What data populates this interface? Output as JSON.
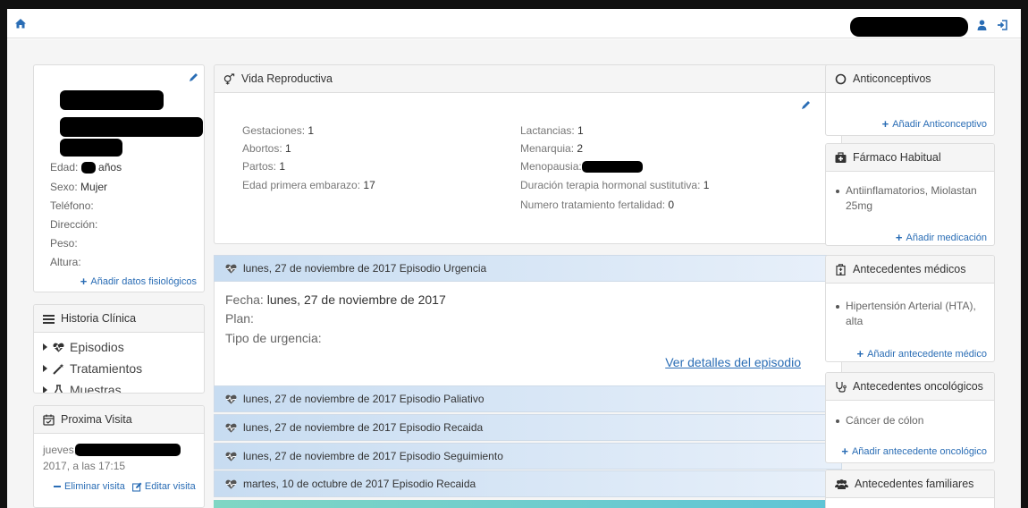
{
  "navbar": {
    "home_icon": "home-icon",
    "user_icon": "user-icon",
    "logout_icon": "sign-out-icon"
  },
  "profile": {
    "edad_label": "Edad:",
    "edad_unit": "años",
    "sexo_label": "Sexo:",
    "sexo_value": "Mujer",
    "telefono_label": "Teléfono:",
    "direccion_label": "Dirección:",
    "peso_label": "Peso:",
    "altura_label": "Altura:",
    "add_fisio": "Añadir datos fisiológicos"
  },
  "historia": {
    "title": "Historia Clínica",
    "items": [
      "Episodios",
      "Tratamientos",
      "Muestras"
    ]
  },
  "proxima": {
    "title": "Proxima Visita",
    "date_prefix": "jueves,",
    "date_suffix": "2017, a las 17:15",
    "eliminar": "Eliminar visita",
    "editar": "Editar visita"
  },
  "vida": {
    "title": "Vida Reproductiva",
    "left": [
      {
        "label": "Gestaciones:",
        "value": "1"
      },
      {
        "label": "Abortos:",
        "value": "1"
      },
      {
        "label": "Partos:",
        "value": "1"
      },
      {
        "label": "Edad primera embarazo:",
        "value": "17"
      }
    ],
    "right": [
      {
        "label": "Lactancias:",
        "value": "1"
      },
      {
        "label": "Menarquia:",
        "value": "2"
      },
      {
        "label": "Menopausia:",
        "value": ""
      },
      {
        "label": "Duración terapia hormonal sustitutiva:",
        "value": "1"
      },
      {
        "label": "Numero tratamiento fertalidad:",
        "value": "0"
      }
    ]
  },
  "episodios": {
    "open_title": "lunes, 27 de noviembre de 2017 Episodio Urgencia",
    "fecha_label": "Fecha:",
    "fecha_value": "lunes, 27 de noviembre de 2017",
    "plan_label": "Plan:",
    "tipo_label": "Tipo de urgencia:",
    "detalles": "Ver detalles del episodio",
    "collapsed": [
      "lunes, 27 de noviembre de 2017 Episodio Paliativo",
      "lunes, 27 de noviembre de 2017 Episodio Recaida",
      "lunes, 27 de noviembre de 2017 Episodio Seguimiento",
      "martes, 10 de octubre de 2017 Episodio Recaida"
    ]
  },
  "right": {
    "anticonceptivos": {
      "title": "Anticonceptivos",
      "add": "Añadir Anticonceptivo"
    },
    "farmaco": {
      "title": "Fármaco Habitual",
      "item": "Antiinflamatorios, Miolastan 25mg",
      "add": "Añadir medicación"
    },
    "medicos": {
      "title": "Antecedentes médicos",
      "item": "Hipertensión Arterial (HTA), alta",
      "add": "Añadir antecedente médico"
    },
    "oncologicos": {
      "title": "Antecedentes oncológicos",
      "item": "Cáncer de cólon",
      "add": "Añadir antecedente oncológico"
    },
    "familiares": {
      "title": "Antecedentes familiares"
    }
  },
  "colors": {
    "link": "#2a6db5",
    "episode_bar": "#c7dcf1",
    "teal": "#5ec4d6"
  }
}
